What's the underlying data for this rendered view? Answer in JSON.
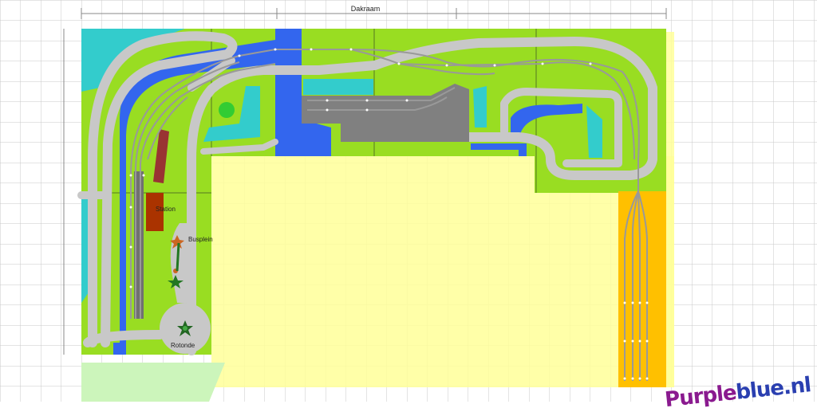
{
  "dimension_label": "Dakraam",
  "labels": {
    "station": "Station",
    "busplein": "Busplein",
    "rotonde": "Rotonde"
  },
  "watermark": {
    "part1": "Purple",
    "part2": "blue.nl"
  },
  "colors": {
    "grass": "#99dd22",
    "water_light": "#33cccc",
    "water_dark": "#3366ee",
    "road": "#c8c8c8",
    "building": "#808080",
    "station": "#aa3300",
    "yard": "#ffc000",
    "floor": "#ffff99",
    "grid": "#cccccc"
  }
}
